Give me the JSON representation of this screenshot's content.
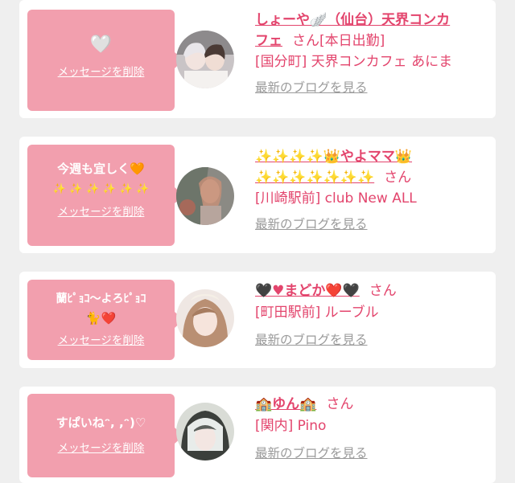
{
  "colors": {
    "accent": "#e3456d",
    "bubble": "#f29fae",
    "link_gray": "#9a9a9a",
    "bg": "#efefef"
  },
  "delete_label": "メッセージを削除",
  "blog_label": "最新のブログを見る",
  "san_label": "さん",
  "cards": [
    {
      "message_line1": "🤍",
      "message_line2": "",
      "name_line1": "しょーや🪽（仙台）天界コンカ",
      "name_line2": "フェ",
      "suffix": "さん[本日出勤]",
      "shop": "[国分町] 天界コンカフェ あにま"
    },
    {
      "message_line1": "今週も宜しく🧡",
      "message_line2": "✨ ✨ ✨ ✨ ✨ ✨",
      "name_line1": "✨✨✨✨👑やよママ👑",
      "name_line2": "✨✨✨✨✨✨✨",
      "suffix": "さん",
      "shop": "[川崎駅前] club New ALL"
    },
    {
      "message_line1": "蘭ﾋﾟｮｺ〜よろﾋﾟｮｺ",
      "message_line2": "🐈❤️",
      "name_line1": "🖤♥まどか❤️🖤",
      "name_line2": "",
      "suffix": "さん",
      "shop": "[町田駅前] ルーブル"
    },
    {
      "message_line1": "すぱいねᵔ, ,ᵔ)♡",
      "message_line2": "",
      "name_line1": "🏫ゆん🏫",
      "name_line2": "",
      "suffix": "さん",
      "shop": "[関内] Pino"
    }
  ]
}
